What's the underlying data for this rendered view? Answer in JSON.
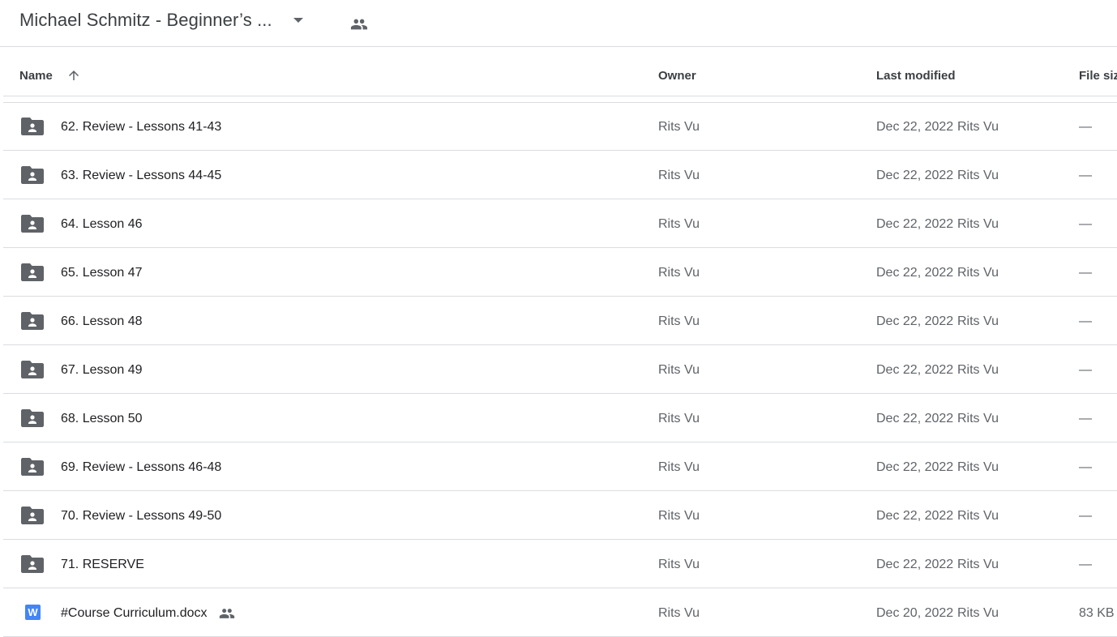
{
  "topbar": {
    "folder_title": "Michael Schmitz - Beginner’s ...",
    "dropdown_icon": "arrow-drop-down-icon",
    "shared_icon": "people-icon"
  },
  "columns": {
    "name": "Name",
    "owner": "Owner",
    "last_modified": "Last modified",
    "file_size": "File size",
    "sort_icon": "arrow-upward-icon"
  },
  "rows": [
    {
      "name": "62. Review - Lessons 41-43",
      "owner": "Rits Vu",
      "modified": "Dec 22, 2022",
      "modified_by": "Rits Vu",
      "size": "—",
      "type": "shared-folder"
    },
    {
      "name": "63. Review - Lessons 44-45",
      "owner": "Rits Vu",
      "modified": "Dec 22, 2022",
      "modified_by": "Rits Vu",
      "size": "—",
      "type": "shared-folder"
    },
    {
      "name": "64. Lesson 46",
      "owner": "Rits Vu",
      "modified": "Dec 22, 2022",
      "modified_by": "Rits Vu",
      "size": "—",
      "type": "shared-folder"
    },
    {
      "name": "65. Lesson 47",
      "owner": "Rits Vu",
      "modified": "Dec 22, 2022",
      "modified_by": "Rits Vu",
      "size": "—",
      "type": "shared-folder"
    },
    {
      "name": "66. Lesson 48",
      "owner": "Rits Vu",
      "modified": "Dec 22, 2022",
      "modified_by": "Rits Vu",
      "size": "—",
      "type": "shared-folder"
    },
    {
      "name": "67. Lesson 49",
      "owner": "Rits Vu",
      "modified": "Dec 22, 2022",
      "modified_by": "Rits Vu",
      "size": "—",
      "type": "shared-folder"
    },
    {
      "name": "68. Lesson 50",
      "owner": "Rits Vu",
      "modified": "Dec 22, 2022",
      "modified_by": "Rits Vu",
      "size": "—",
      "type": "shared-folder"
    },
    {
      "name": "69. Review - Lessons 46-48",
      "owner": "Rits Vu",
      "modified": "Dec 22, 2022",
      "modified_by": "Rits Vu",
      "size": "—",
      "type": "shared-folder"
    },
    {
      "name": "70. Review - Lessons 49-50",
      "owner": "Rits Vu",
      "modified": "Dec 22, 2022",
      "modified_by": "Rits Vu",
      "size": "—",
      "type": "shared-folder"
    },
    {
      "name": "71. RESERVE",
      "owner": "Rits Vu",
      "modified": "Dec 22, 2022",
      "modified_by": "Rits Vu",
      "size": "—",
      "type": "shared-folder"
    },
    {
      "name": "#Course Curriculum.docx",
      "owner": "Rits Vu",
      "modified": "Dec 20, 2022",
      "modified_by": "Rits Vu",
      "size": "83 KB",
      "type": "word-doc",
      "doc_letter": "W",
      "shared": true
    }
  ],
  "colors": {
    "folder_icon": "#5f6368",
    "word_icon": "#4285f4",
    "divider": "#dadce0"
  }
}
